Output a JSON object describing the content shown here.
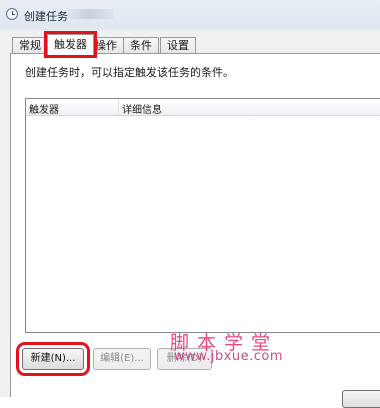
{
  "window": {
    "title": "创建任务"
  },
  "tabs": [
    {
      "label": "常规"
    },
    {
      "label": "触发器"
    },
    {
      "label": "操作"
    },
    {
      "label": "条件"
    },
    {
      "label": "设置"
    }
  ],
  "active_tab": "触发器",
  "triggers": {
    "description": "创建任务时，可以指定触发该任务的条件。",
    "columns": [
      "触发器",
      "详细信息"
    ],
    "rows": []
  },
  "buttons": {
    "new": "新建(N)...",
    "edit": "编辑(E)...",
    "delete": "删除(D)"
  },
  "watermark": {
    "chinese": "脚本学堂",
    "url": "www.jbxue.com"
  },
  "colors": {
    "highlight": "#e2121a",
    "watermark": "#e64882"
  }
}
